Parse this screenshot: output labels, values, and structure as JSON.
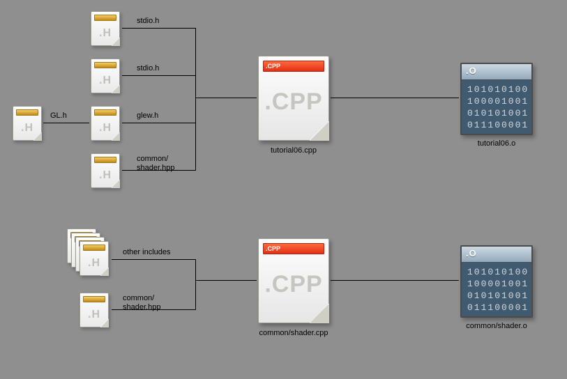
{
  "top": {
    "gl_h": "GL.h",
    "includes": [
      "stdio.h",
      "stdio.h",
      "glew.h",
      "common/\nshader.hpp"
    ],
    "cpp_badge": ".CPP",
    "cpp_ext": ".CPP",
    "cpp_caption": "tutorial06.cpp",
    "o_badge": ".O",
    "o_bits": "101010100\n100001001\n010101001\n011100001",
    "o_caption": "tutorial06.o"
  },
  "bottom": {
    "stack_label": "other includes",
    "include": "common/\nshader.hpp",
    "cpp_badge": ".CPP",
    "cpp_ext": ".CPP",
    "cpp_caption": "common/shader.cpp",
    "o_badge": ".O",
    "o_bits": "101010100\n100001001\n010101001\n011100001",
    "o_caption": "common/shader.o"
  }
}
